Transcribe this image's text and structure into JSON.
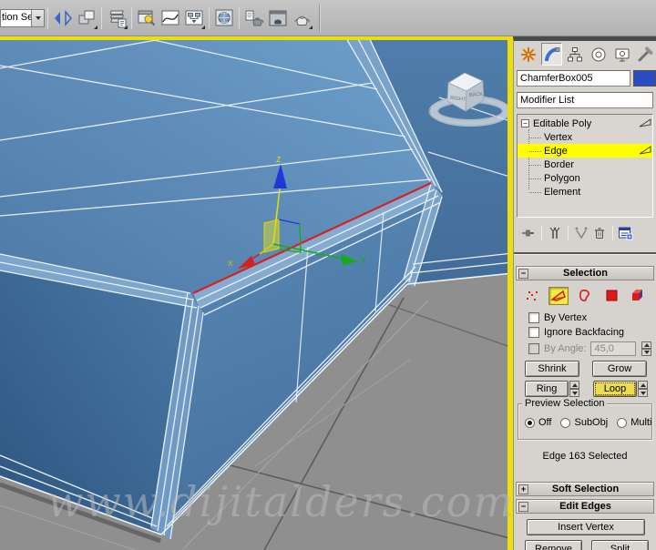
{
  "toolbar": {
    "selection_set_value": "tion Se",
    "icons": [
      "mirror",
      "align",
      "layer-manager",
      "scene-explorer",
      "curve-editor",
      "schematic-view",
      "material-editor",
      "render-setup",
      "rendered-frame-window",
      "render-production"
    ]
  },
  "command_panel": {
    "tabs": [
      "create",
      "modify",
      "hierarchy",
      "motion",
      "display",
      "utilities"
    ],
    "active_tab": "modify",
    "object_name": "ChamferBox005",
    "object_color": "#2a4cc0",
    "modifier_list_label": "Modifier List",
    "stack": {
      "root_label": "Editable Poly",
      "items": [
        "Vertex",
        "Edge",
        "Border",
        "Polygon",
        "Element"
      ],
      "selected_item": "Edge",
      "highlight_color": "#ffff00"
    },
    "selection_rollout": {
      "title": "Selection",
      "subobject_icons": [
        "vertex",
        "edge",
        "border",
        "polygon",
        "element"
      ],
      "active_subobject": "edge",
      "checkboxes": {
        "by_vertex": "By Vertex",
        "ignore_backfacing": "Ignore Backfacing",
        "by_angle": "By Angle:"
      },
      "by_angle_value": "45,0",
      "buttons": {
        "shrink": "Shrink",
        "grow": "Grow",
        "ring": "Ring",
        "loop": "Loop"
      },
      "loop_highlight_color": "#ecdc4e",
      "preview_selection": {
        "title": "Preview Selection",
        "options": [
          "Off",
          "SubObj",
          "Multi"
        ],
        "selected": "Off"
      },
      "status": "Edge 163 Selected"
    },
    "soft_selection_title": "Soft Selection",
    "edit_edges": {
      "title": "Edit Edges",
      "insert_vertex": "Insert Vertex",
      "remove": "Remove",
      "split": "Split"
    }
  },
  "viewport": {
    "watermark": "www.dijitalders.com",
    "gizmo": {
      "x_label": "x",
      "y_label": "y",
      "z_label": "z"
    },
    "viewcube": {
      "left_face": "RIGHT",
      "right_face": "BACK"
    },
    "selected_edge_color": "#d42222",
    "active_border_color": "#ecdf07"
  }
}
